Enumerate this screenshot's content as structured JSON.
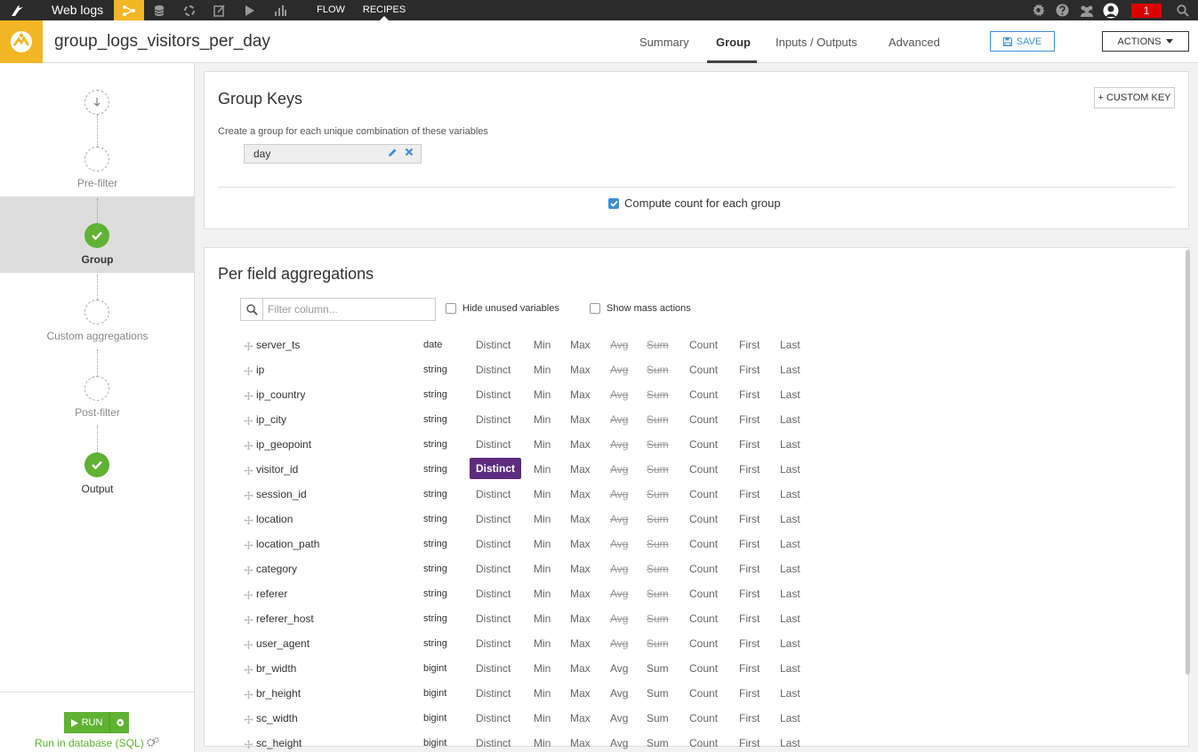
{
  "topbar": {
    "project": "Web logs",
    "links": [
      "FLOW",
      "RECIPES"
    ],
    "notification_count": "1",
    "icons": [
      "bird-logo-icon",
      "flow-icon",
      "datasets-icon",
      "recipes-icon",
      "notebook-icon",
      "run-icon",
      "dashboard-icon",
      "gear-icon",
      "help-icon",
      "users-icon",
      "avatar-icon",
      "search-icon"
    ]
  },
  "header": {
    "recipe_name": "group_logs_visitors_per_day",
    "tabs": [
      "Summary",
      "Group",
      "Inputs / Outputs",
      "Advanced"
    ],
    "active_tab": "Group",
    "save_label": "SAVE",
    "actions_label": "ACTIONS"
  },
  "sidebar": {
    "steps": [
      "Pre-filter",
      "Group",
      "Custom aggregations",
      "Post-filter",
      "Output"
    ],
    "run_label": "RUN",
    "engine_label": "Run in database (SQL)"
  },
  "group_keys": {
    "title": "Group Keys",
    "custom_key_label": "+ CUSTOM KEY",
    "description": "Create a group for each unique combination of these variables",
    "keys": [
      "day"
    ],
    "compute_count_label": "Compute count for each group",
    "compute_count_checked": true
  },
  "aggregations": {
    "title": "Per field aggregations",
    "filter_placeholder": "Filter column...",
    "hide_unused_label": "Hide unused variables",
    "show_mass_label": "Show mass actions",
    "agg_labels": [
      "Distinct",
      "Min",
      "Max",
      "Avg",
      "Sum",
      "Count",
      "First",
      "Last"
    ],
    "columns": [
      {
        "name": "server_ts",
        "type": "date",
        "numeric": false
      },
      {
        "name": "ip",
        "type": "string",
        "numeric": false
      },
      {
        "name": "ip_country",
        "type": "string",
        "numeric": false
      },
      {
        "name": "ip_city",
        "type": "string",
        "numeric": false
      },
      {
        "name": "ip_geopoint",
        "type": "string",
        "numeric": false
      },
      {
        "name": "visitor_id",
        "type": "string",
        "numeric": false,
        "selected": "Distinct"
      },
      {
        "name": "session_id",
        "type": "string",
        "numeric": false
      },
      {
        "name": "location",
        "type": "string",
        "numeric": false
      },
      {
        "name": "location_path",
        "type": "string",
        "numeric": false
      },
      {
        "name": "category",
        "type": "string",
        "numeric": false
      },
      {
        "name": "referer",
        "type": "string",
        "numeric": false
      },
      {
        "name": "referer_host",
        "type": "string",
        "numeric": false
      },
      {
        "name": "user_agent",
        "type": "string",
        "numeric": false
      },
      {
        "name": "br_width",
        "type": "bigint",
        "numeric": true
      },
      {
        "name": "br_height",
        "type": "bigint",
        "numeric": true
      },
      {
        "name": "sc_width",
        "type": "bigint",
        "numeric": true
      },
      {
        "name": "sc_height",
        "type": "bigint",
        "numeric": true
      }
    ]
  },
  "colors": {
    "topbar_bg": "#2b2b2b",
    "accent_yellow": "#f3b624",
    "success_green": "#5fb233",
    "link_blue": "#3f8fd2",
    "selected_purple": "#5c2d7e"
  }
}
